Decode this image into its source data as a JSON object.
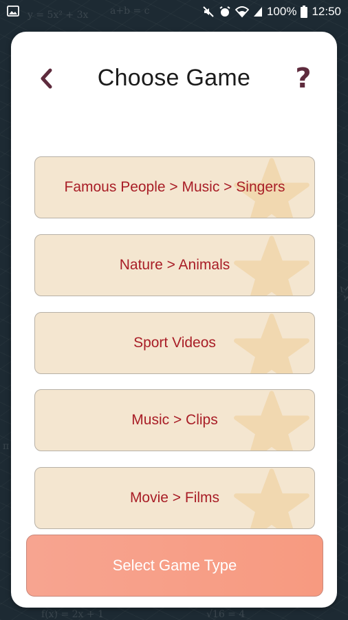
{
  "status_bar": {
    "battery": "100%",
    "time": "12:50",
    "icons": [
      "image-icon",
      "mute-icon",
      "alarm-icon",
      "wifi-icon",
      "signal-icon",
      "battery-icon"
    ]
  },
  "header": {
    "title": "Choose Game",
    "back_icon": "chevron-left-icon",
    "help_label": "?"
  },
  "games": [
    {
      "label": "Famous People > Music > Singers"
    },
    {
      "label": "Nature > Animals"
    },
    {
      "label": "Sport Videos"
    },
    {
      "label": "Music > Clips"
    },
    {
      "label": "Movie > Films"
    }
  ],
  "footer": {
    "select_label": "Select Game Type"
  },
  "colors": {
    "item_bg": "#f4e6d0",
    "item_text": "#a81d26",
    "accent": "#f79a80",
    "help": "#5e2b3d"
  }
}
